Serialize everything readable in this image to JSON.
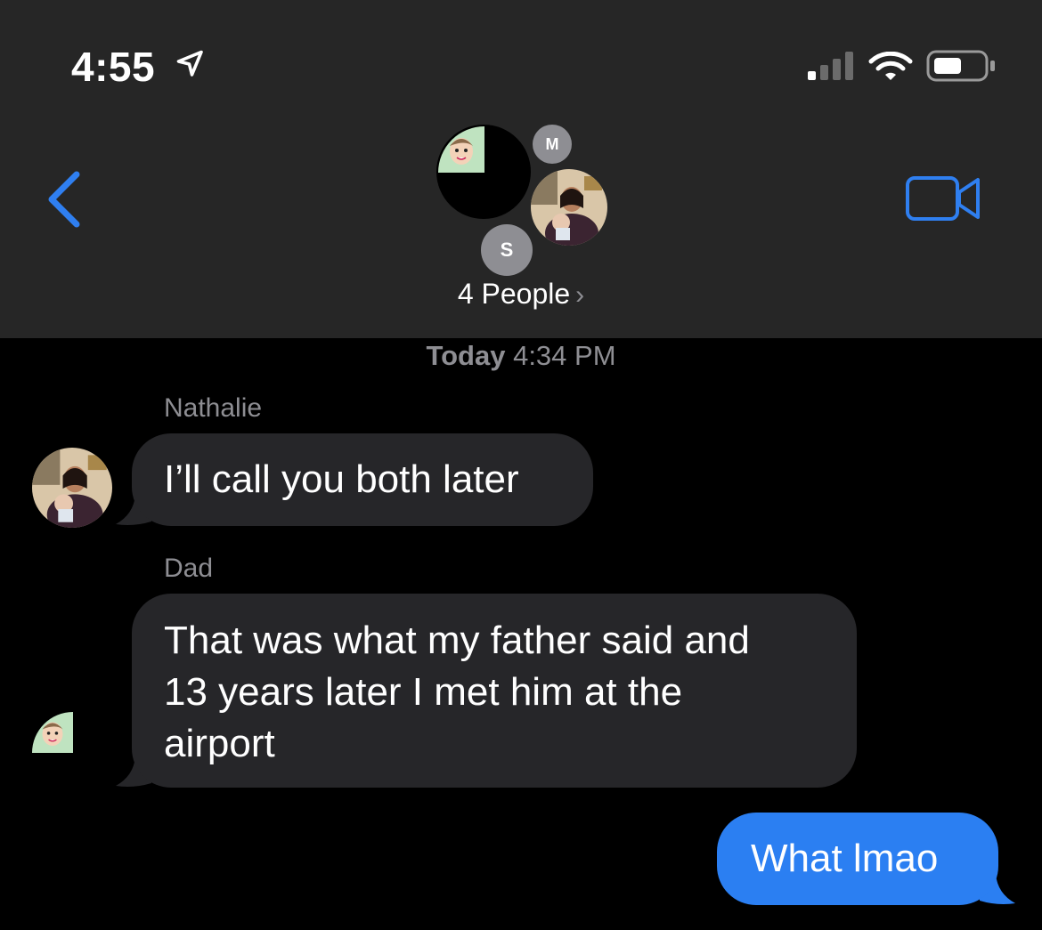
{
  "status_bar": {
    "time": "4:55"
  },
  "header": {
    "members": [
      {
        "initial": "M"
      },
      {
        "initial": "S"
      }
    ],
    "title": "4 People"
  },
  "conversation": {
    "timestamp_day": "Today",
    "timestamp_time": "4:34 PM",
    "messages": [
      {
        "sender": "Nathalie",
        "text": "I’ll call you both later",
        "outgoing": false
      },
      {
        "sender": "Dad",
        "lines": [
          "That was what my father said and",
          "13 years later I met him at the",
          "airport"
        ],
        "outgoing": false
      },
      {
        "text": "What lmao",
        "outgoing": true
      }
    ]
  },
  "colors": {
    "header_bg": "#262626",
    "incoming_bubble": "#262629",
    "outgoing_bubble": "#2b7ff2",
    "accent_blue": "#2f7ff0",
    "secondary_text": "#8e8e93"
  }
}
